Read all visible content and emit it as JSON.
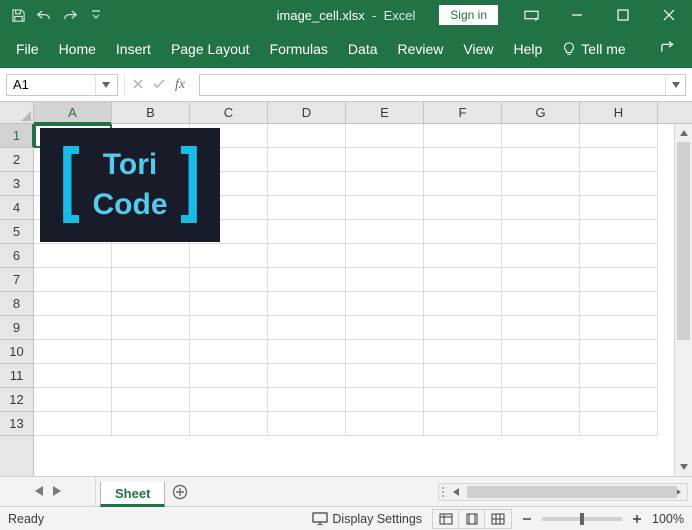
{
  "titlebar": {
    "filename": "image_cell.xlsx",
    "appname": "Excel",
    "signin": "Sign in"
  },
  "ribbon": {
    "tabs": [
      "File",
      "Home",
      "Insert",
      "Page Layout",
      "Formulas",
      "Data",
      "Review",
      "View",
      "Help"
    ],
    "tellme": "Tell me"
  },
  "namebox": {
    "value": "A1"
  },
  "formulabar": {
    "value": "",
    "fxlabel": "fx"
  },
  "columns": [
    "A",
    "B",
    "C",
    "D",
    "E",
    "F",
    "G",
    "H"
  ],
  "rows": [
    "1",
    "2",
    "3",
    "4",
    "5",
    "6",
    "7",
    "8",
    "9",
    "10",
    "11",
    "12",
    "13"
  ],
  "active": {
    "col": "A",
    "row": "1"
  },
  "embedded_image": {
    "line1": "Tori",
    "line2": "Code"
  },
  "sheet": {
    "name": "Sheet"
  },
  "statusbar": {
    "ready": "Ready",
    "display_settings": "Display Settings",
    "zoom": "100%"
  }
}
